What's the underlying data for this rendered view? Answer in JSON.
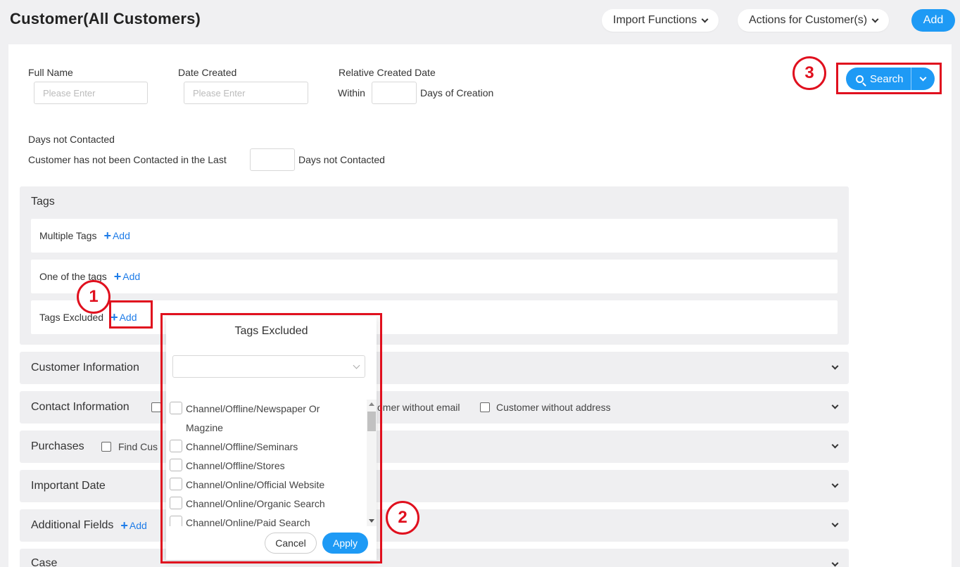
{
  "header": {
    "title": "Customer(All Customers)",
    "import_label": "Import Functions",
    "actions_label": "Actions for Customer(s)",
    "add_label": "Add"
  },
  "filters": {
    "full_name_label": "Full Name",
    "full_name_placeholder": "Please Enter",
    "date_created_label": "Date Created",
    "date_created_placeholder": "Please Enter",
    "relative_label": "Relative Created Date",
    "within_label": "Within",
    "days_of_creation_label": "Days of Creation",
    "days_not_contacted_title": "Days not Contacted",
    "not_contacted_prefix": "Customer has not been Contacted in the Last",
    "not_contacted_suffix": "Days not Contacted",
    "search_label": "Search"
  },
  "tags": {
    "title": "Tags",
    "multiple_label": "Multiple Tags",
    "one_of_label": "One of the tags",
    "excluded_label": "Tags Excluded",
    "add_label": "Add"
  },
  "sections": {
    "customer_info": "Customer Information",
    "contact_info": "Contact Information",
    "contact_opt_partial": "omer without email",
    "contact_opt_address": "Customer without address",
    "purchases": "Purchases",
    "purchases_opt_partial": "Find Cus",
    "important_date": "Important Date",
    "additional_fields": "Additional Fields",
    "additional_add": "Add",
    "case": "Case"
  },
  "popup": {
    "title": "Tags Excluded",
    "options": [
      "Channel/Offline/Newspaper Or Magzine",
      "Channel/Offline/Seminars",
      "Channel/Offline/Stores",
      "Channel/Online/Official Website",
      "Channel/Online/Organic Search",
      "Channel/Online/Paid Search"
    ],
    "cancel_label": "Cancel",
    "apply_label": "Apply"
  },
  "annotations": {
    "step1": "1",
    "step2": "2",
    "step3": "3"
  },
  "colors": {
    "accent": "#1e9af5",
    "highlight": "#e0101e",
    "link": "#1e7ce8"
  }
}
